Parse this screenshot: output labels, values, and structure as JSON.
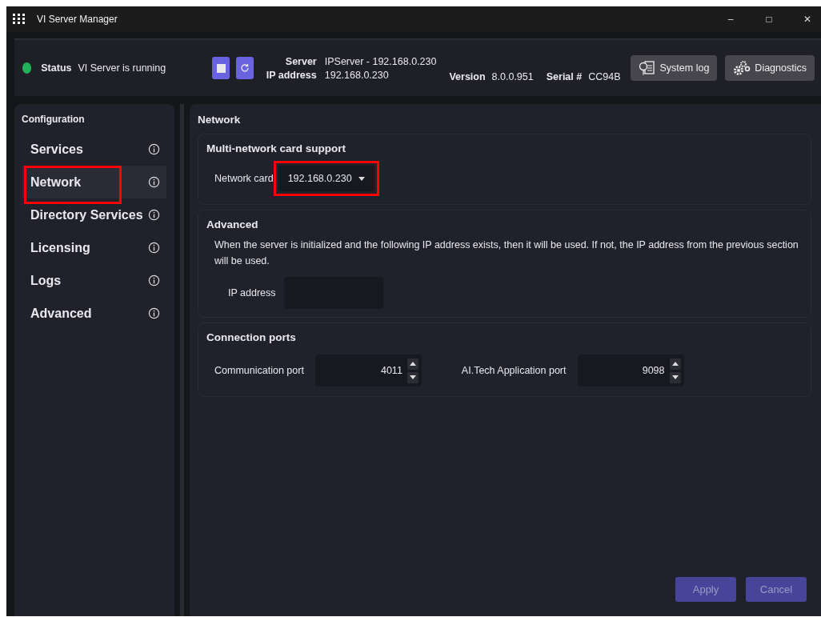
{
  "window": {
    "title": "VI Server Manager",
    "controls": [
      "–",
      "□",
      "✕"
    ]
  },
  "header": {
    "status_label": "Status",
    "status_text": "VI Server is running",
    "running": true,
    "server_label": "Server",
    "server_value": "IPServer - 192.168.0.230",
    "ip_label": "IP address",
    "ip_value": "192.168.0.230",
    "version_label": "Version",
    "version_value": "8.0.0.951",
    "serial_label": "Serial #",
    "serial_value": "CC94B",
    "buttons": [
      {
        "kind": "log",
        "label": "System log"
      },
      {
        "kind": "diagnostics",
        "label": "Diagnostics"
      }
    ]
  },
  "sidebar": {
    "title": "Configuration",
    "items": [
      {
        "label": "Services",
        "selected": false,
        "highlighted": false
      },
      {
        "label": "Network",
        "selected": true,
        "highlighted": true
      },
      {
        "label": "Directory Services",
        "selected": false,
        "highlighted": false
      },
      {
        "label": "Licensing",
        "selected": false,
        "highlighted": false
      },
      {
        "label": "Logs",
        "selected": false,
        "highlighted": false
      },
      {
        "label": "Advanced",
        "selected": false,
        "highlighted": false
      }
    ]
  },
  "main": {
    "title": "Network",
    "multi": {
      "title": "Multi-network card support",
      "label": "Network card",
      "value": "192.168.0.230",
      "highlighted": true
    },
    "advanced": {
      "title": "Advanced",
      "description": "When the server is initialized and the following IP address exists, then it will be used. If not, the IP address from the previous section will be used.",
      "ip_label": "IP address"
    },
    "ports": {
      "title": "Connection ports",
      "fields": [
        {
          "label": "Communication port",
          "value": "4011"
        },
        {
          "label": "AI.Tech Application port",
          "value": "9098"
        }
      ]
    },
    "actions": [
      {
        "label": "Apply",
        "disabled": true
      },
      {
        "label": "Cancel",
        "disabled": true
      }
    ]
  }
}
